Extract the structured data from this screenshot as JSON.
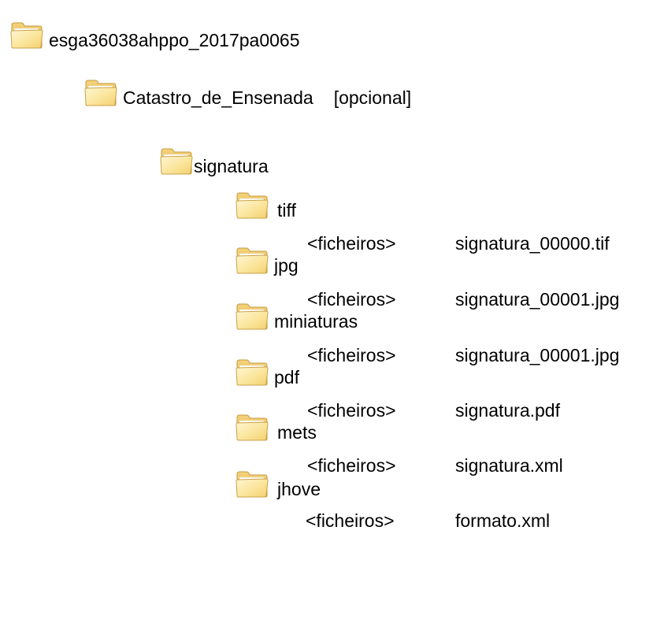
{
  "tree": {
    "root": {
      "label": "esga36038ahppo_2017pa0065",
      "icon": "folder-icon"
    },
    "level1": {
      "label": "Catastro_de_Ensenada",
      "note": "[opcional]",
      "icon": "folder-icon"
    },
    "level2": {
      "label": "signatura",
      "icon": "folder-icon"
    },
    "subfolders": [
      {
        "label": "tiff",
        "files_tag": "<ficheiros>",
        "file": "signatura_00000.tif",
        "icon": "folder-icon"
      },
      {
        "label": "jpg",
        "files_tag": "<ficheiros>",
        "file": "signatura_00001.jpg",
        "icon": "folder-icon"
      },
      {
        "label": "miniaturas",
        "files_tag": "<ficheiros>",
        "file": "signatura_00001.jpg",
        "icon": "folder-icon"
      },
      {
        "label": "pdf",
        "files_tag": "<ficheiros>",
        "file": "signatura.pdf",
        "icon": "folder-icon"
      },
      {
        "label": "mets",
        "files_tag": "<ficheiros>",
        "file": "signatura.xml",
        "icon": "folder-icon"
      },
      {
        "label": "jhove",
        "files_tag": "<ficheiros>",
        "file": "formato.xml",
        "icon": "folder-icon"
      }
    ]
  },
  "colors": {
    "folder_fill": "#f7dc88",
    "folder_light": "#fdf0bf",
    "folder_stroke": "#c9a24a",
    "text": "#000000"
  }
}
